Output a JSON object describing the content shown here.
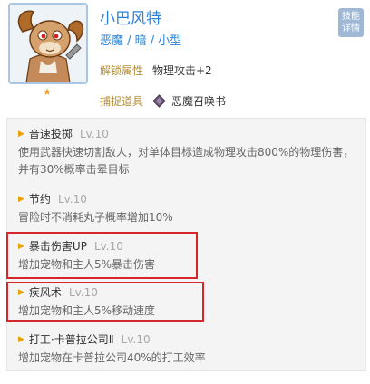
{
  "pet": {
    "name": "小巴风特",
    "tags": "恶魔 / 暗 / 小型",
    "stars": "★",
    "skill_detail_button": "技能\n详情"
  },
  "attributes": {
    "unlock_label": "解锁属性",
    "unlock_value": "物理攻击+2",
    "capture_label": "捕捉道具",
    "capture_icon": "book-icon",
    "capture_value": "恶魔召唤书"
  },
  "skills": [
    {
      "name": "音速投掷",
      "level": "Lv.10",
      "desc1": "使用武器快速切割敌人，对单体目标造成物理攻击800%的物理伤害，",
      "desc2": "并有30%概率击晕目标"
    },
    {
      "name": "节约",
      "level": "Lv.10",
      "desc1": "冒险时不消耗丸子概率增加10%"
    },
    {
      "name": "暴击伤害UP",
      "level": "Lv.10",
      "desc1": "增加宠物和主人5%暴击伤害"
    },
    {
      "name": "疾风术",
      "level": "Lv.10",
      "desc1": "增加宠物和主人5%移动速度"
    },
    {
      "name": "打工·卡普拉公司Ⅱ",
      "level": "Lv.10",
      "desc1": "增加宠物在卡普拉公司40%的打工效率"
    }
  ],
  "colors": {
    "accent_blue": "#2a83d8",
    "label_gold": "#b58e3a",
    "highlight_red": "#d7262b",
    "triangle_orange": "#e7a100"
  }
}
